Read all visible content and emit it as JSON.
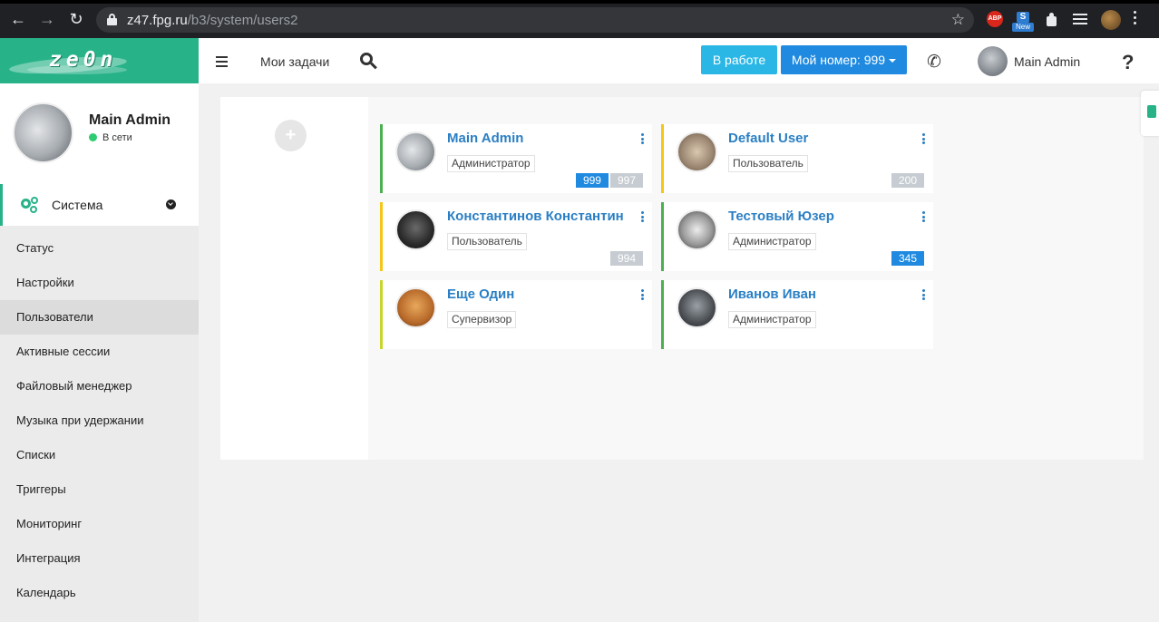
{
  "browser": {
    "url_host": "z47.fpg.ru",
    "url_path": "/b3/system/users2",
    "extensions": {
      "abp_label": "ABP",
      "new_label": "New",
      "new_glyph": "S"
    }
  },
  "header": {
    "logo_text": "ze0n",
    "tasks_label": "Мои задачи",
    "status_button": "В работе",
    "number_button": "Мой номер: 999",
    "user_name": "Main Admin",
    "help_label": "?"
  },
  "sidebar": {
    "profile_name": "Main Admin",
    "profile_status": "В сети",
    "section_label": "Система",
    "items": [
      {
        "label": "Статус"
      },
      {
        "label": "Настройки"
      },
      {
        "label": "Пользователи",
        "active": true
      },
      {
        "label": "Активные сессии"
      },
      {
        "label": "Файловый менеджер"
      },
      {
        "label": "Музыка при удержании"
      },
      {
        "label": "Списки"
      },
      {
        "label": "Триггеры"
      },
      {
        "label": "Мониторинг"
      },
      {
        "label": "Интеграция"
      },
      {
        "label": "Календарь"
      }
    ]
  },
  "content": {
    "add_label": "+",
    "users": [
      {
        "name": "Main Admin",
        "role": "Администратор",
        "accent": "#4caf50",
        "numbers": [
          {
            "value": "999",
            "style": "blue"
          },
          {
            "value": "997",
            "style": "grey"
          }
        ]
      },
      {
        "name": "Default User",
        "role": "Пользователь",
        "accent": "#f5c518",
        "numbers": [
          {
            "value": "200",
            "style": "grey"
          }
        ]
      },
      {
        "name": "Константинов Константин",
        "role": "Пользователь",
        "accent": "#f5c518",
        "numbers": [
          {
            "value": "994",
            "style": "grey"
          }
        ]
      },
      {
        "name": "Тестовый Юзер",
        "role": "Администратор",
        "accent": "#4caf50",
        "numbers": [
          {
            "value": "345",
            "style": "blue"
          }
        ]
      },
      {
        "name": "Еще Один",
        "role": "Супервизор",
        "accent": "#c8d62b",
        "numbers": []
      },
      {
        "name": "Иванов Иван",
        "role": "Администратор",
        "accent": "#4caf50",
        "numbers": []
      }
    ]
  },
  "colors": {
    "brand": "#27b288",
    "link": "#2a7fc4",
    "button_work": "#2ab7e6",
    "button_number": "#1f8ae0",
    "online": "#2ecc71"
  }
}
